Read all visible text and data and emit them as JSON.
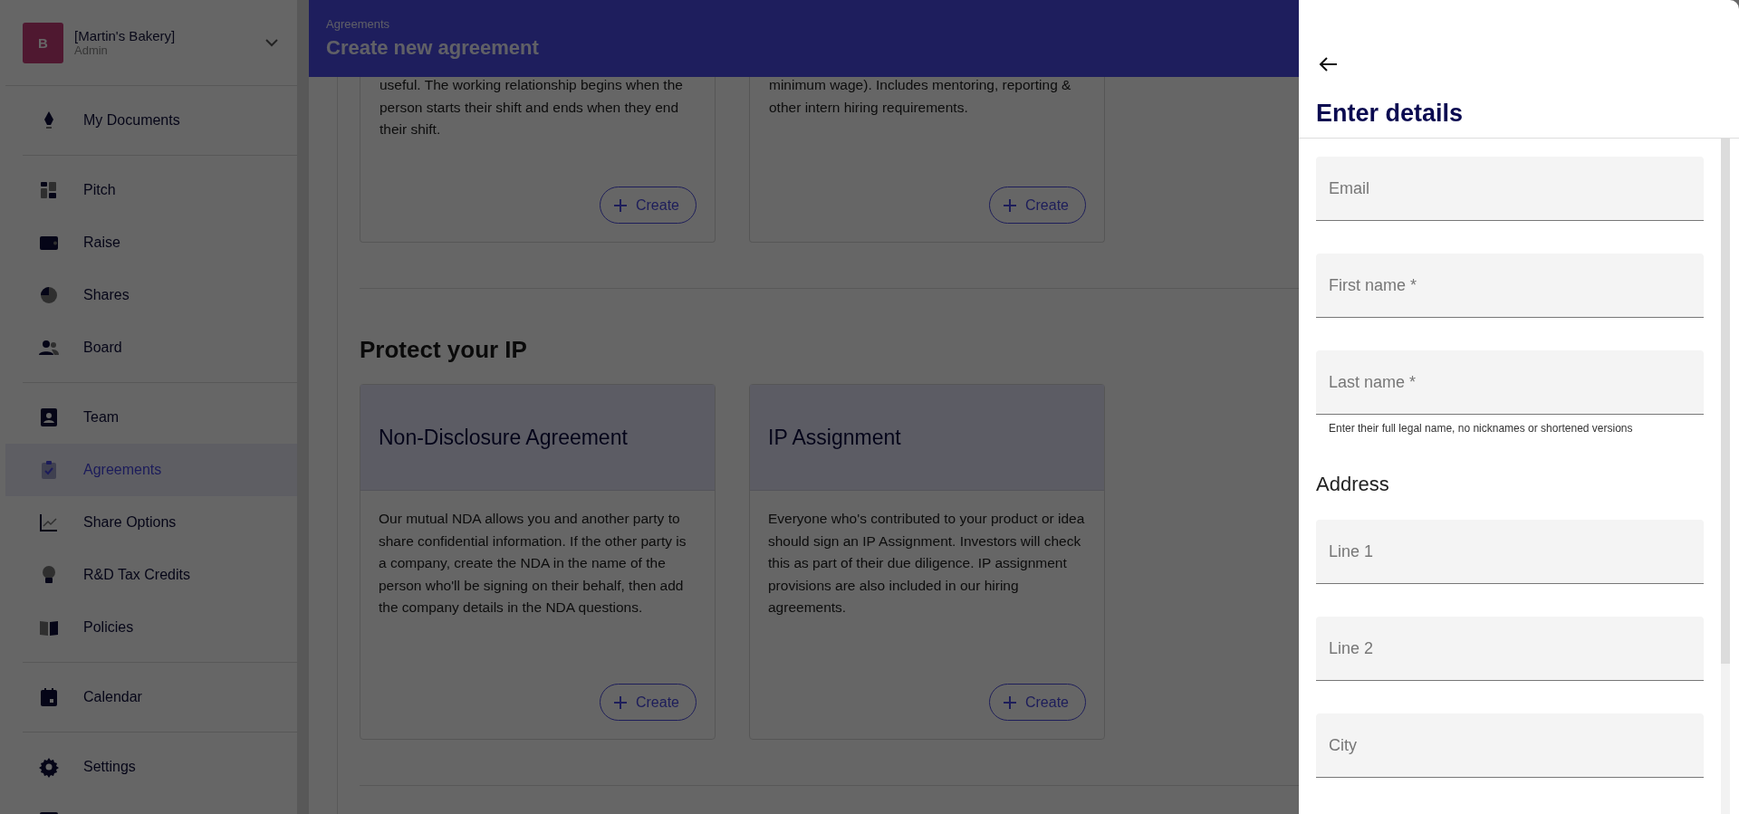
{
  "sidebar": {
    "company": {
      "initial": "B",
      "name": "[Martin's Bakery]",
      "role": "Admin"
    },
    "groups": [
      [
        {
          "kind": "pen",
          "label": "My Documents",
          "selected": false
        }
      ],
      [
        {
          "kind": "tiles",
          "label": "Pitch",
          "selected": false
        },
        {
          "kind": "wallet",
          "label": "Raise",
          "selected": false
        },
        {
          "kind": "pie",
          "label": "Shares",
          "selected": false
        },
        {
          "kind": "people",
          "label": "Board",
          "selected": false
        }
      ],
      [
        {
          "kind": "badge",
          "label": "Team",
          "selected": false
        },
        {
          "kind": "clipboard",
          "label": "Agreements",
          "selected": true
        },
        {
          "kind": "chart",
          "label": "Share Options",
          "selected": false
        },
        {
          "kind": "bulb",
          "label": "R&D Tax Credits",
          "selected": false
        },
        {
          "kind": "book",
          "label": "Policies",
          "selected": false
        }
      ],
      [
        {
          "kind": "calendar",
          "label": "Calendar",
          "selected": false
        }
      ],
      [
        {
          "kind": "gear",
          "label": "Settings",
          "selected": false
        },
        {
          "kind": "box",
          "selected": false
        }
      ]
    ]
  },
  "header": {
    "breadcrumb": "Agreements",
    "title": "Create new agreement"
  },
  "top_cards": [
    {
      "text": "useful. The working relationship begins when the person starts their shift and ends when they end their shift.",
      "button": "Create"
    },
    {
      "text": "minimum wage). Includes mentoring, reporting & other intern hiring requirements.",
      "button": "Create"
    }
  ],
  "section": {
    "title": "Protect your IP",
    "cards": [
      {
        "title": "Non-Disclosure Agreement",
        "text": "Our mutual NDA allows you and another party to share confidential information. If the other party is a company, create the NDA in the name of the person who'll be signing on their behalf, then add the company details in the NDA questions.",
        "button": "Create"
      },
      {
        "title": "IP Assignment",
        "text": "Everyone who's contributed to your product or idea should sign an IP Assignment. Investors will check this as part of their due diligence. IP assignment provisions are also included in our hiring agreements.",
        "button": "Create"
      }
    ]
  },
  "drawer": {
    "title": "Enter details",
    "items": [
      {
        "kind": "field",
        "placeholder": "Email"
      },
      {
        "kind": "field",
        "placeholder": "First name *"
      },
      {
        "kind": "field",
        "placeholder": "Last name *"
      },
      {
        "kind": "helper",
        "text": "Enter their full legal name, no nicknames or shortened versions"
      },
      {
        "kind": "heading",
        "text": "Address"
      },
      {
        "kind": "field",
        "placeholder": "Line 1"
      },
      {
        "kind": "field",
        "placeholder": "Line 2"
      },
      {
        "kind": "field",
        "placeholder": "City"
      }
    ]
  }
}
